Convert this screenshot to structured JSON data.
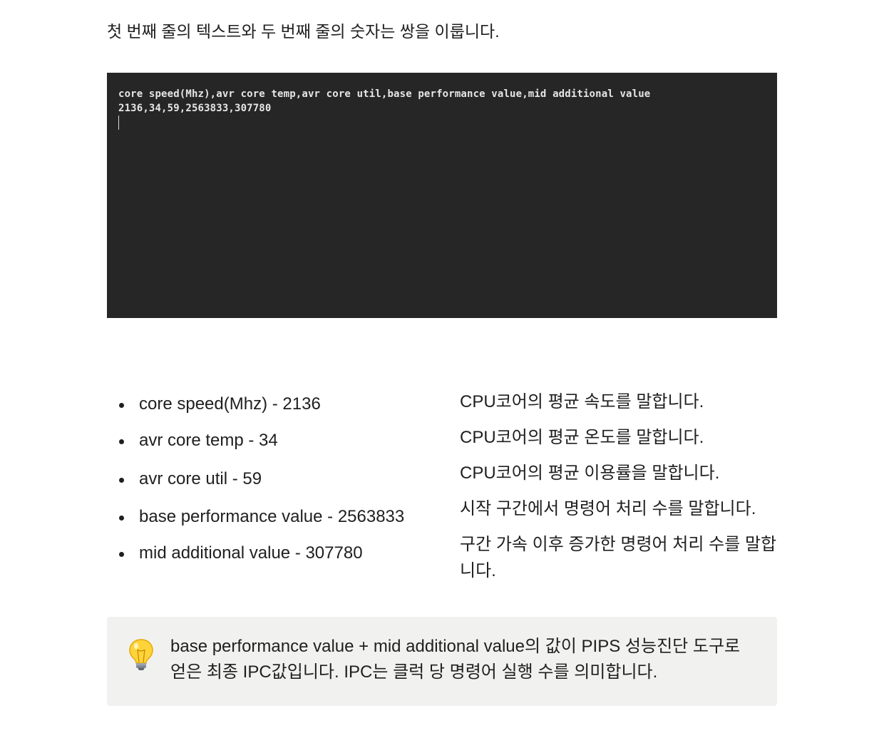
{
  "intro": {
    "text": "첫 번째 줄의 텍스트와 두 번째 줄의 숫자는 쌍을 이룹니다."
  },
  "terminal": {
    "line1": "core speed(Mhz),avr core temp,avr core util,base performance value,mid additional value",
    "line2": "2136,34,59,2563833,307780"
  },
  "fields": [
    {
      "label": "core speed(Mhz) - 2136",
      "description": "CPU코어의 평균 속도를 말합니다."
    },
    {
      "label": "avr core temp - 34",
      "description": "CPU코어의 평균 온도를 말합니다."
    },
    {
      "label": "avr core util - 59",
      "description": "CPU코어의 평균 이용률을 말합니다."
    },
    {
      "label": "base performance value - 2563833",
      "description": "시작 구간에서 명령어 처리 수를 말합니다."
    },
    {
      "label": "mid additional value - 307780",
      "description": "구간 가속 이후 증가한 명령어 처리 수를 말합니다."
    }
  ],
  "callout": {
    "icon": "lightbulb-icon",
    "text": "base performance value + mid additional value의 값이 PIPS 성능진단 도구로 얻은 최종 IPC값입니다. IPC는 클럭 당 명령어 실행 수를 의미합니다."
  },
  "colors": {
    "terminal_background": "#262626",
    "terminal_text": "#e6e6e6",
    "callout_background": "#f1f1ef",
    "body_text": "#1f1f1f"
  }
}
